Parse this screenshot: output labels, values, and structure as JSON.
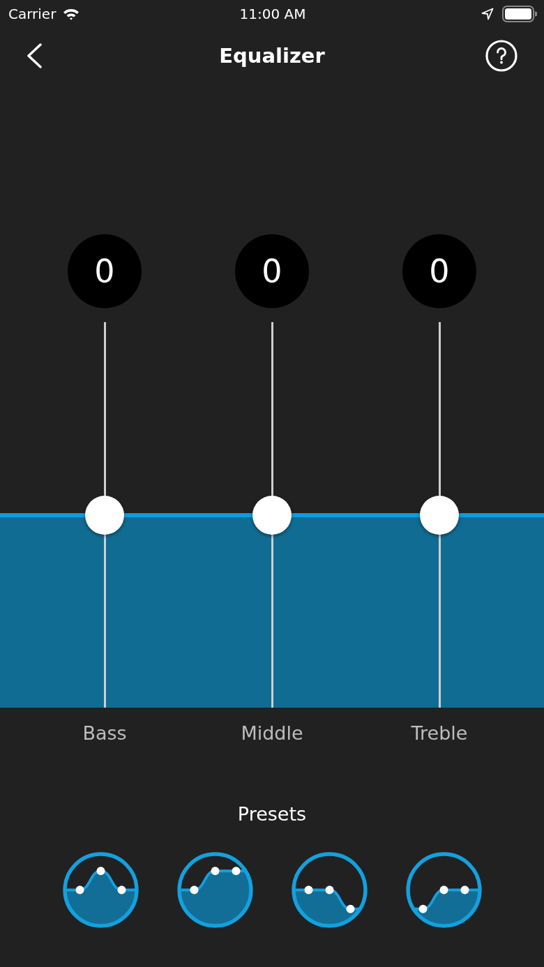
{
  "status_bar": {
    "carrier": "Carrier",
    "time": "11:00 AM"
  },
  "nav": {
    "title": "Equalizer"
  },
  "channels": [
    {
      "name": "Bass",
      "value": "0",
      "level": 0.5
    },
    {
      "name": "Middle",
      "value": "0",
      "level": 0.5
    },
    {
      "name": "Treble",
      "value": "0",
      "level": 0.5
    }
  ],
  "presets": {
    "title": "Presets",
    "items": [
      {
        "kind": "mid-boost"
      },
      {
        "kind": "treble-boost"
      },
      {
        "kind": "treble-cut"
      },
      {
        "kind": "bass-cut"
      }
    ]
  }
}
